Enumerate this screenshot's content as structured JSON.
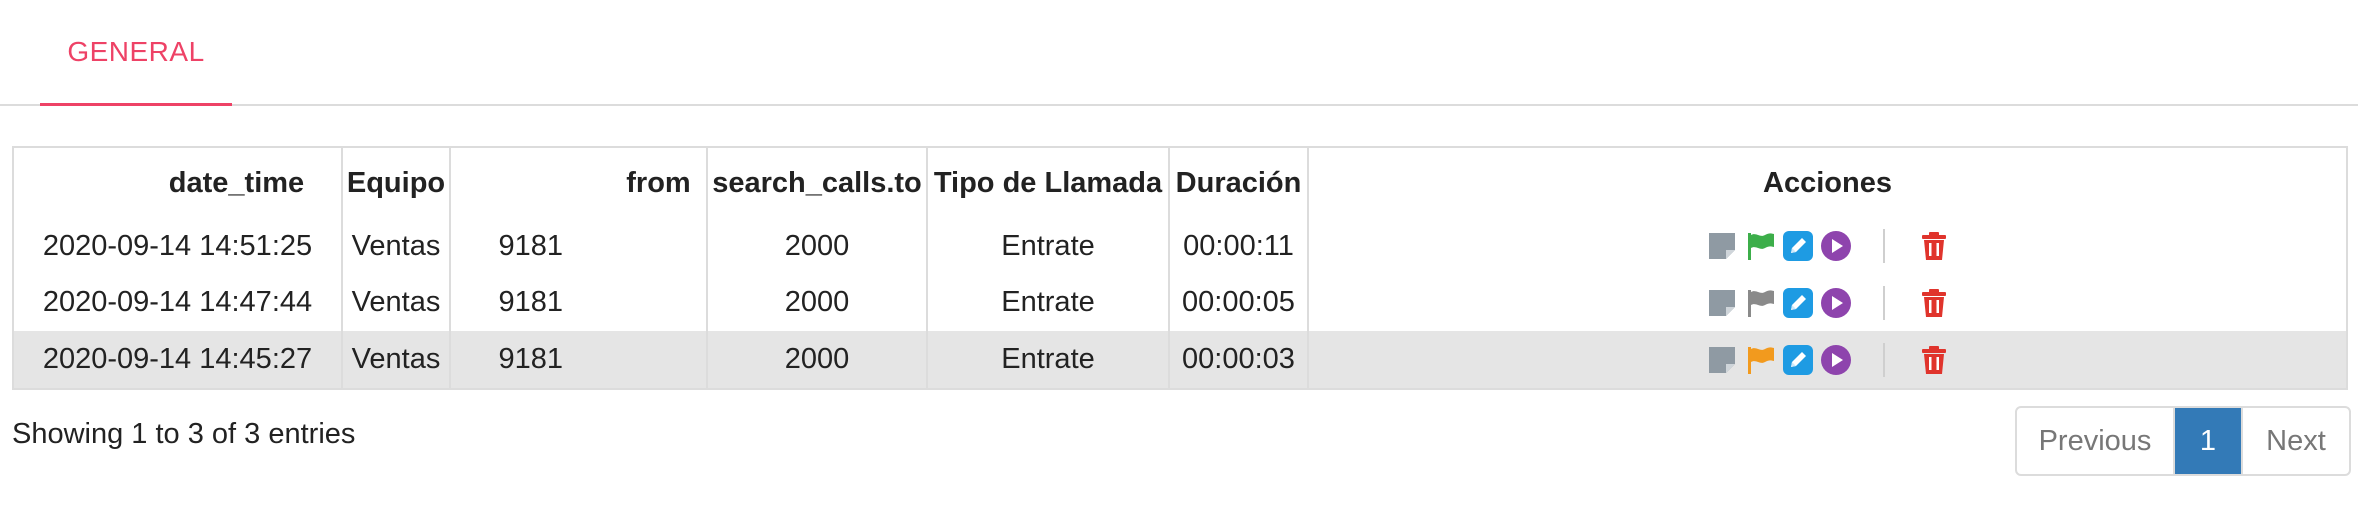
{
  "tabs": [
    {
      "label": "GENERAL"
    }
  ],
  "table": {
    "headers": [
      "date_time",
      "Equipo",
      "from",
      "search_calls.to",
      "Tipo de Llamada",
      "Duración",
      "Acciones"
    ],
    "rows": [
      {
        "date_time": "2020-09-14 14:51:25",
        "equipo": "Ventas",
        "from": "9181",
        "to": "2000",
        "tipo": "Entrate",
        "duracion": "00:00:11",
        "flag_color": "#3cae4a"
      },
      {
        "date_time": "2020-09-14 14:47:44",
        "equipo": "Ventas",
        "from": "9181",
        "to": "2000",
        "tipo": "Entrate",
        "duracion": "00:00:05",
        "flag_color": "#8a8a8a"
      },
      {
        "date_time": "2020-09-14 14:45:27",
        "equipo": "Ventas",
        "from": "9181",
        "to": "2000",
        "tipo": "Entrate",
        "duracion": "00:00:03",
        "flag_color": "#f29a1e"
      }
    ],
    "action_icons": [
      "note-icon",
      "flag-icon",
      "edit-icon",
      "play-icon",
      "trash-icon"
    ]
  },
  "footer": {
    "info": "Showing 1 to 3 of 3 entries",
    "pagination": {
      "previous": "Previous",
      "current": "1",
      "next": "Next"
    }
  },
  "colors": {
    "accent": "#ee4266",
    "note": "#8f9aa3",
    "edit": "#1e9be3",
    "play": "#8e44ad",
    "trash": "#e0342c",
    "pager_active": "#337ab7"
  }
}
